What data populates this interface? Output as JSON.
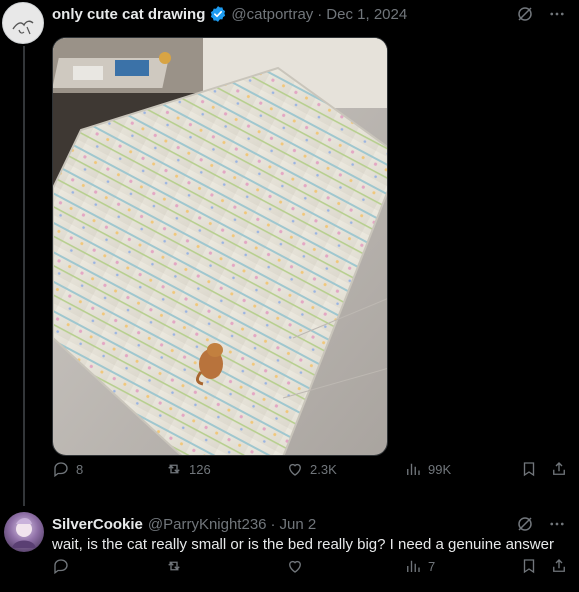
{
  "post": {
    "author_name": "only cute cat drawing",
    "handle": "@catportray",
    "separator": "·",
    "date": "Dec 1, 2024",
    "image_icon": "cat-on-bed-photo",
    "stats": {
      "replies": "8",
      "reposts": "126",
      "likes": "2.3K",
      "views": "99K"
    }
  },
  "reply": {
    "author_name": "SilverCookie",
    "handle": "@ParryKnight236",
    "separator": "·",
    "date": "Jun 2",
    "text": "wait, is the cat really small or is the bed really big? I need a genuine answer",
    "stats": {
      "views": "7"
    }
  },
  "colors": {
    "background": "#000000",
    "text": "#e7e9ea",
    "muted": "#71767b",
    "verified": "#1d9bf0"
  },
  "icons": {
    "verified": "verified-badge-icon",
    "grok": "grok-icon",
    "more": "more-icon",
    "reply": "reply-icon",
    "repost": "repost-icon",
    "like": "heart-icon",
    "views": "views-icon",
    "bookmark": "bookmark-icon",
    "share": "share-icon"
  }
}
